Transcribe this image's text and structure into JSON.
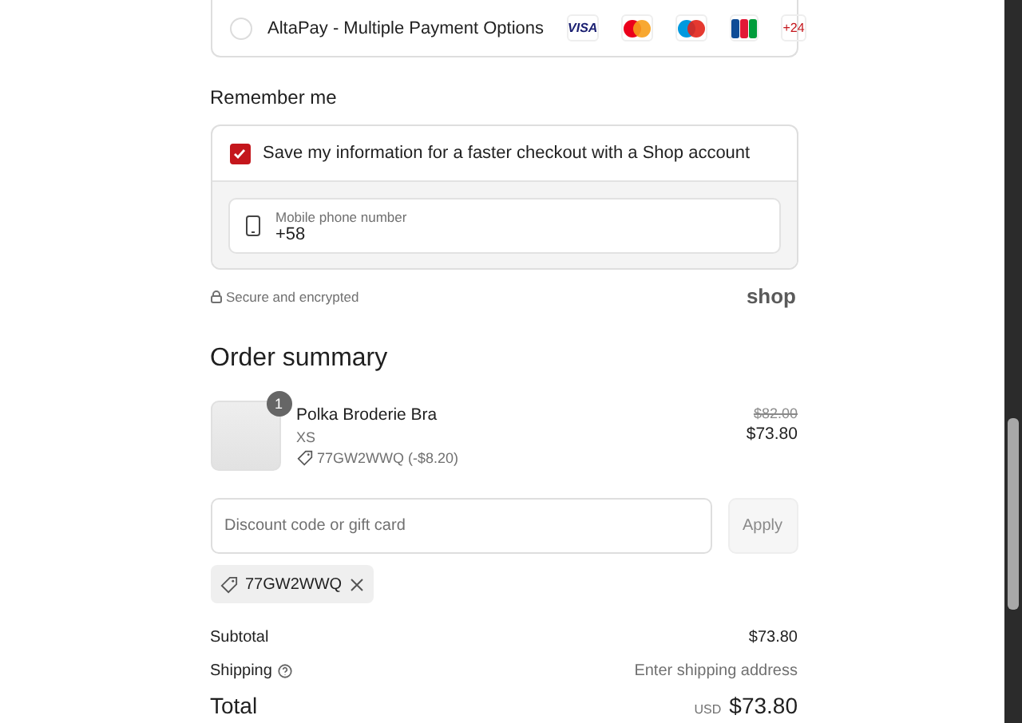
{
  "payment_option": {
    "label": "AltaPay - Multiple Payment Options",
    "selected": false,
    "cards": [
      {
        "kind": "visa",
        "label": "VISA"
      },
      {
        "kind": "mastercard"
      },
      {
        "kind": "maestro"
      },
      {
        "kind": "jcb"
      }
    ],
    "more": "+24"
  },
  "remember_me": {
    "heading": "Remember me",
    "save_label": "Save my information for a faster checkout with a Shop account",
    "checked": true,
    "phone": {
      "placeholder": "Mobile phone number",
      "value": "+58"
    }
  },
  "secure_note": "Secure and encrypted",
  "shop_logo": "shop",
  "order_summary": {
    "heading": "Order summary",
    "items": [
      {
        "name": "Polka Broderie Bra",
        "quantity": "1",
        "variant": "XS",
        "discount": "77GW2WWQ (-$8.20)",
        "original_price": "$82.00",
        "price": "$73.80"
      }
    ],
    "discount_field": {
      "placeholder": "Discount code or gift card"
    },
    "apply_button": "Apply",
    "applied_codes": [
      "77GW2WWQ"
    ],
    "subtotal": {
      "label": "Subtotal",
      "value": "$73.80"
    },
    "shipping": {
      "label": "Shipping",
      "value": "Enter shipping address"
    },
    "total": {
      "label": "Total",
      "currency": "USD",
      "value": "$73.80"
    }
  }
}
